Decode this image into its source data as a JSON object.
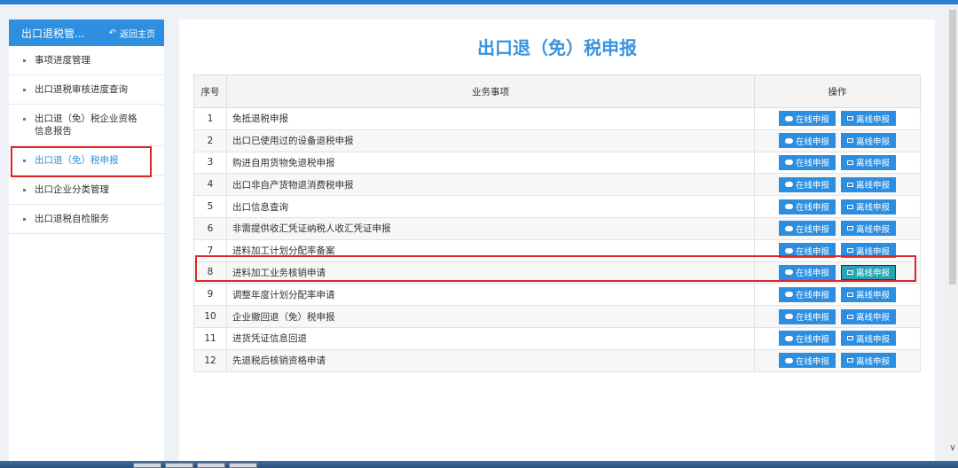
{
  "sidebar": {
    "title": "出口退税管...",
    "back_label": "返回主页",
    "items": [
      {
        "label": "事项进度管理"
      },
      {
        "label": "出口退税审核进度查询"
      },
      {
        "label": "出口退（免）税企业资格信息报告"
      },
      {
        "label": "出口退（免）税申报"
      },
      {
        "label": "出口企业分类管理"
      },
      {
        "label": "出口退税自检服务"
      }
    ],
    "active_index": 3
  },
  "main": {
    "title": "出口退（免）税申报",
    "columns": [
      "序号",
      "业务事项",
      "操作"
    ],
    "online_label": "在线申报",
    "offline_label": "离线申报",
    "rows": [
      {
        "no": "1",
        "item": "免抵退税申报"
      },
      {
        "no": "2",
        "item": "出口已使用过的设备退税申报"
      },
      {
        "no": "3",
        "item": "购进自用货物免退税申报"
      },
      {
        "no": "4",
        "item": "出口非自产货物退消费税申报"
      },
      {
        "no": "5",
        "item": "出口信息查询"
      },
      {
        "no": "6",
        "item": "非需提供收汇凭证纳税人收汇凭证申报"
      },
      {
        "no": "7",
        "item": "进料加工计划分配率备案"
      },
      {
        "no": "8",
        "item": "进料加工业务核销申请"
      },
      {
        "no": "9",
        "item": "调整年度计划分配率申请"
      },
      {
        "no": "10",
        "item": "企业撤回退（免）税申报"
      },
      {
        "no": "11",
        "item": "进货凭证信息回退"
      },
      {
        "no": "12",
        "item": "先退税后核销资格申请"
      }
    ],
    "highlighted_row": 8
  },
  "colors": {
    "accent": "#2e8fe0",
    "highlight": "#e02525",
    "pressed_button": "#27a3b6"
  },
  "icons": {
    "online": "cloud-upload-icon",
    "offline": "monitor-icon",
    "back": "reply-arrow-icon"
  }
}
